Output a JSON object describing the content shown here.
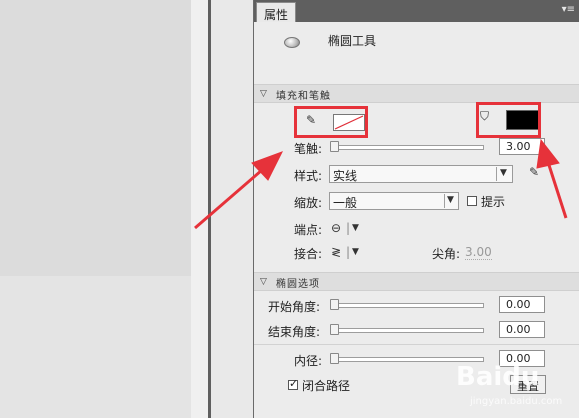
{
  "panel": {
    "tab_label": "属性",
    "menu_glyph": "▾≡",
    "tool_name": "椭圆工具"
  },
  "fill_stroke": {
    "section_title": "填充和笔触",
    "stroke_label": "笔触:",
    "stroke_value": "3.00",
    "style_label": "样式:",
    "style_value": "实线",
    "scale_label": "缩放:",
    "scale_value": "一般",
    "hint_label": "提示",
    "cap_label": "端点:",
    "join_label": "接合:",
    "miter_label": "尖角:",
    "miter_value": "3.00"
  },
  "oval": {
    "section_title": "椭圆选项",
    "start_angle_label": "开始角度:",
    "start_angle_value": "0.00",
    "end_angle_label": "结束角度:",
    "end_angle_value": "0.00",
    "inner_radius_label": "内径:",
    "inner_radius_value": "0.00",
    "close_path_label": "闭合路径",
    "reset_label": "重置"
  },
  "colors": {
    "annotation": "#e6323a",
    "fill_color": "#000000",
    "stroke_swatch": "#ffffff"
  },
  "watermark": {
    "brand": "Baidu",
    "sub": "jingyan.baidu.com"
  }
}
